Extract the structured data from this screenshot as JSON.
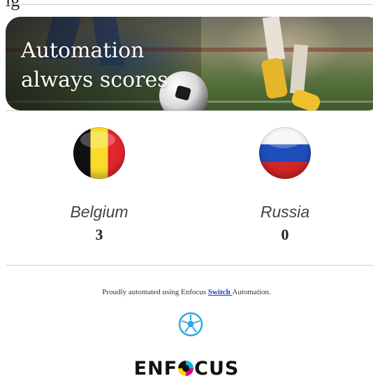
{
  "header": {
    "partial_title": "ig"
  },
  "banner": {
    "line1": "Automation",
    "line2": "always scores"
  },
  "teams": [
    {
      "name": "Belgium",
      "score": "3",
      "flag_icon": "belgium-flag-icon"
    },
    {
      "name": "Russia",
      "score": "0",
      "flag_icon": "russia-flag-icon"
    }
  ],
  "footer": {
    "prefix": "Proudly automated using Enfocus ",
    "link_text": "Switch ",
    "suffix": "Automation.",
    "ball_icon": "soccer-ball-icon",
    "logo_text_left": "ENF",
    "logo_text_right": "CUS"
  },
  "colors": {
    "link": "#1a3ad6",
    "icon_blue": "#2fa8e6"
  }
}
